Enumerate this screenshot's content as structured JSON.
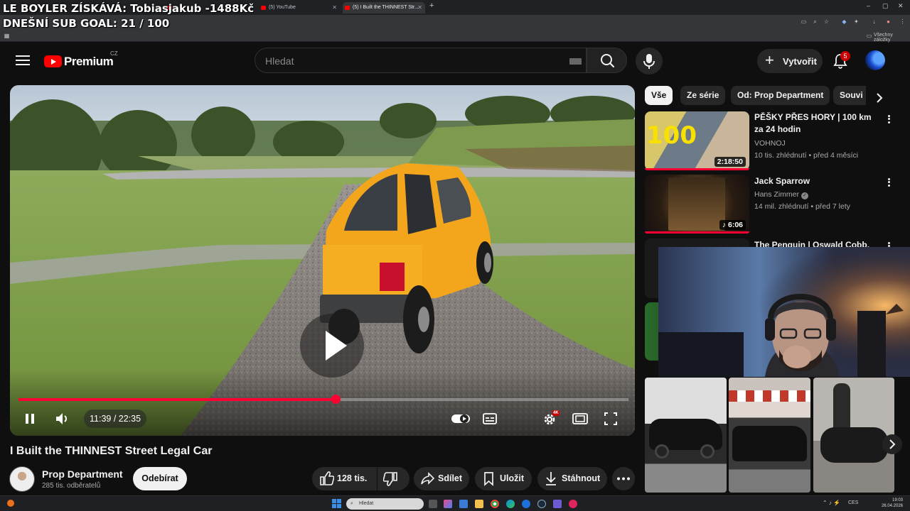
{
  "browser": {
    "tabs": [
      {
        "label": "",
        "active": false
      },
      {
        "label": "(5) YouTube",
        "active": false
      },
      {
        "label": "(5) I Built the THINNEST Str...",
        "active": true
      }
    ],
    "new_tab": "+",
    "bookmarks_all": "Všechny záložky",
    "window_controls": [
      "–",
      "▢",
      "✕"
    ]
  },
  "stream_overlay": {
    "line1": "LE BOYLER ZÍSKÁVÁ: Tobiasjakub -1488Kč",
    "line2": "DNEŠNÍ SUB GOAL: 21 / 100"
  },
  "header": {
    "logo_text": "Premium",
    "country": "CZ",
    "search_placeholder": "Hledat",
    "create_label": "Vytvořit",
    "notification_count": "5"
  },
  "player": {
    "time": "11:39 / 22:35",
    "progress": 0.52,
    "quality_badge": "4K"
  },
  "video": {
    "title": "I Built the THINNEST Street Legal Car",
    "channel": "Prop Department",
    "subscribers": "285 tis. odběratelů",
    "subscribe_label": "Odebírat",
    "likes": "128 tis.",
    "share_label": "Sdílet",
    "save_label": "Uložit",
    "download_label": "Stáhnout"
  },
  "chips": [
    "Vše",
    "Ze série",
    "Od: Prop Department",
    "Souvi"
  ],
  "recommendations": [
    {
      "title": "PĚŠKY PŘES HORY | 100 km za 24 hodin",
      "channel": "VOHNOJ",
      "meta": "10 tis. zhlédnutí • před 4 měsíci",
      "duration": "2:18:50"
    },
    {
      "title": "Jack Sparrow",
      "channel": "Hans Zimmer",
      "meta": "14 mil. zhlédnutí • před 7 lety",
      "duration": "6:06"
    },
    {
      "title": "The Penguin | Oswald Cobb, The",
      "channel": "",
      "meta": "",
      "duration": ""
    }
  ],
  "taskbar": {
    "search_placeholder": "Hledat",
    "time": "19:03",
    "date": "26.04.2026",
    "lang": "CES"
  },
  "colors": {
    "accent": "#ff0033",
    "background": "#0f0f0f",
    "chip": "#272727"
  }
}
